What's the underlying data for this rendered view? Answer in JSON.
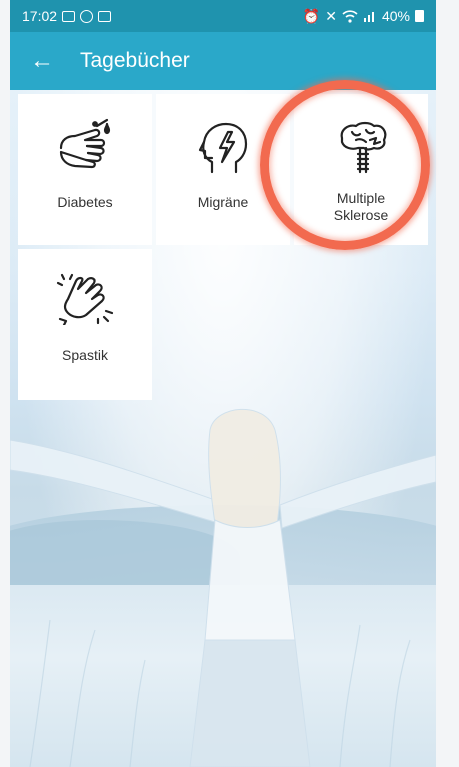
{
  "status_bar": {
    "time": "17:02",
    "battery": "40%"
  },
  "app_bar": {
    "back_icon": "arrow-left",
    "title": "Tagebücher"
  },
  "tiles": [
    {
      "label": "Diabetes",
      "icon": "finger-prick-icon"
    },
    {
      "label": "Migräne",
      "icon": "head-lightning-icon"
    },
    {
      "label": "Multiple Sklerose",
      "label_line1": "Multiple",
      "label_line2": "Sklerose",
      "icon": "brain-spine-icon"
    },
    {
      "label": "Spastik",
      "icon": "cramping-hand-icon"
    }
  ],
  "colors": {
    "status_bar": "#1f93ae",
    "app_bar": "#2aa8c9",
    "highlight": "#f26a4f",
    "tile": "#ffffff"
  }
}
